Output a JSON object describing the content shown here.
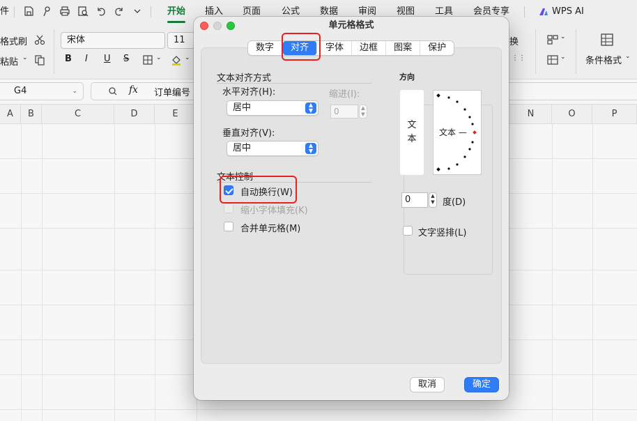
{
  "topbar": {
    "file_partial": "件",
    "tabs": [
      "开始",
      "插入",
      "页面",
      "公式",
      "数据",
      "审阅",
      "视图",
      "工具",
      "会员专享"
    ],
    "active_tab": "开始",
    "wps_ai": "WPS AI"
  },
  "ribbon": {
    "format_painter": "格式刷",
    "paste": "粘贴",
    "font_name": "宋体",
    "font_size": "11",
    "bold": "B",
    "italic": "I",
    "underline": "U",
    "strike": "S",
    "convert_partial": "换",
    "conditional_format": "条件格式"
  },
  "formula": {
    "cell_ref": "G4",
    "fx_label": "fx",
    "content": "订单编号"
  },
  "grid": {
    "columns": [
      "A",
      "B",
      "C",
      "D",
      "E",
      "N",
      "O",
      "P"
    ]
  },
  "dialog": {
    "title": "单元格格式",
    "tabs": [
      "数字",
      "对齐",
      "字体",
      "边框",
      "图案",
      "保护"
    ],
    "active_tab": "对齐",
    "text_alignment_section": "文本对齐方式",
    "horizontal_label": "水平对齐(H):",
    "horizontal_value": "居中",
    "indent_label": "缩进(I):",
    "indent_value": "0",
    "vertical_label": "垂直对齐(V):",
    "vertical_value": "居中",
    "text_control_section": "文本控制",
    "wrap_text": "自动换行(W)",
    "wrap_checked": true,
    "shrink_to_fit": "缩小字体填充(K)",
    "merge_cells": "合并单元格(M)",
    "orientation_section": "方向",
    "vertical_text_chars": [
      "文",
      "本"
    ],
    "dial_text": "文本 —",
    "degree_value": "0",
    "degree_label": "度(D)",
    "vertical_layout": "文字竖排(L)",
    "cancel": "取消",
    "ok": "确定"
  },
  "colors": {
    "accent": "#2f7cf6",
    "active_tab_green": "#1a7f3c",
    "highlight_red": "#e8201f"
  }
}
